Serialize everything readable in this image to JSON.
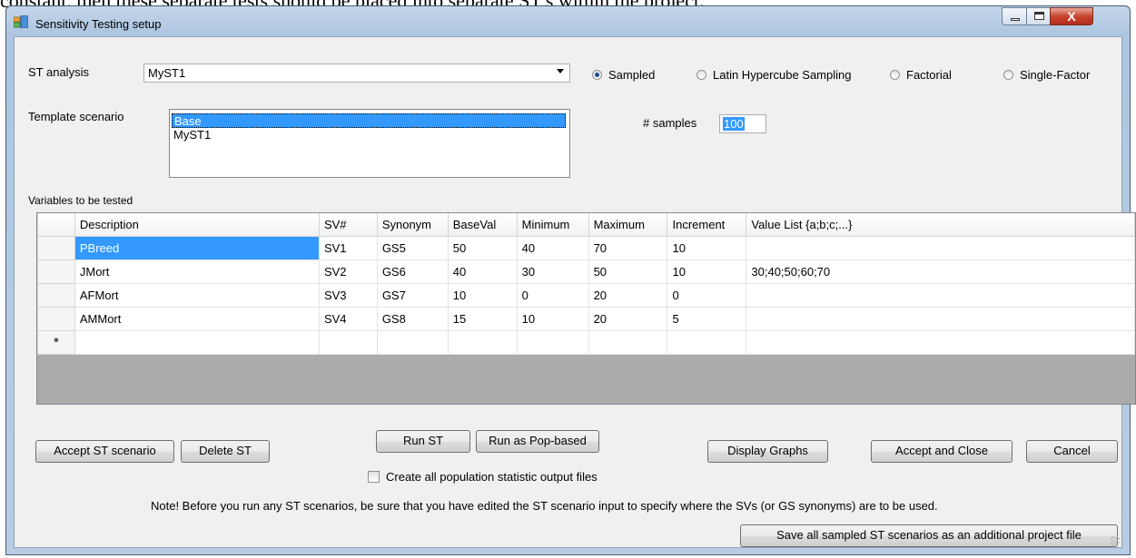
{
  "background_text": "constant, then these separate tests should be placed into separate ST's within the project.",
  "window": {
    "title": "Sensitivity Testing setup",
    "controls": {
      "minimize": "minimize-icon",
      "maximize": "maximize-icon",
      "close": "X"
    }
  },
  "st_analysis": {
    "label": "ST analysis",
    "value": "MyST1"
  },
  "sampling_methods": [
    {
      "label": "Sampled",
      "selected": true
    },
    {
      "label": "Latin Hypercube Sampling",
      "selected": false
    },
    {
      "label": "Factorial",
      "selected": false
    },
    {
      "label": "Single-Factor",
      "selected": false
    }
  ],
  "template_scenario": {
    "label": "Template scenario",
    "items": [
      "Base",
      "MyST1"
    ],
    "selected": "Base"
  },
  "samples": {
    "label": "# samples",
    "value": "100"
  },
  "variables": {
    "label": "Variables to be tested",
    "columns": [
      "Description",
      "SV#",
      "Synonym",
      "BaseVal",
      "Minimum",
      "Maximum",
      "Increment",
      "Value List {a;b;c;...}"
    ],
    "rows": [
      [
        "PBreed",
        "SV1",
        "GS5",
        "50",
        "40",
        "70",
        "10",
        ""
      ],
      [
        "JMort",
        "SV2",
        "GS6",
        "40",
        "30",
        "50",
        "10",
        "30;40;50;60;70"
      ],
      [
        "AFMort",
        "SV3",
        "GS7",
        "10",
        "0",
        "20",
        "0",
        ""
      ],
      [
        "AMMort",
        "SV4",
        "GS8",
        "15",
        "10",
        "20",
        "5",
        ""
      ]
    ],
    "new_row_marker": "*"
  },
  "buttons": {
    "accept_st": "Accept ST scenario",
    "delete_st": "Delete ST",
    "run_st": "Run ST",
    "run_pop": "Run as Pop-based",
    "display_graphs": "Display Graphs",
    "accept_close": "Accept and Close",
    "cancel": "Cancel",
    "save_all": "Save all sampled ST scenarios as an additional project file"
  },
  "create_outputs": {
    "label": "Create all population statistic output files",
    "checked": false
  },
  "note": "Note! Before you run any ST scenarios, be sure that you have edited the ST scenario input to specify where the SVs (or GS synonyms) are to be used."
}
